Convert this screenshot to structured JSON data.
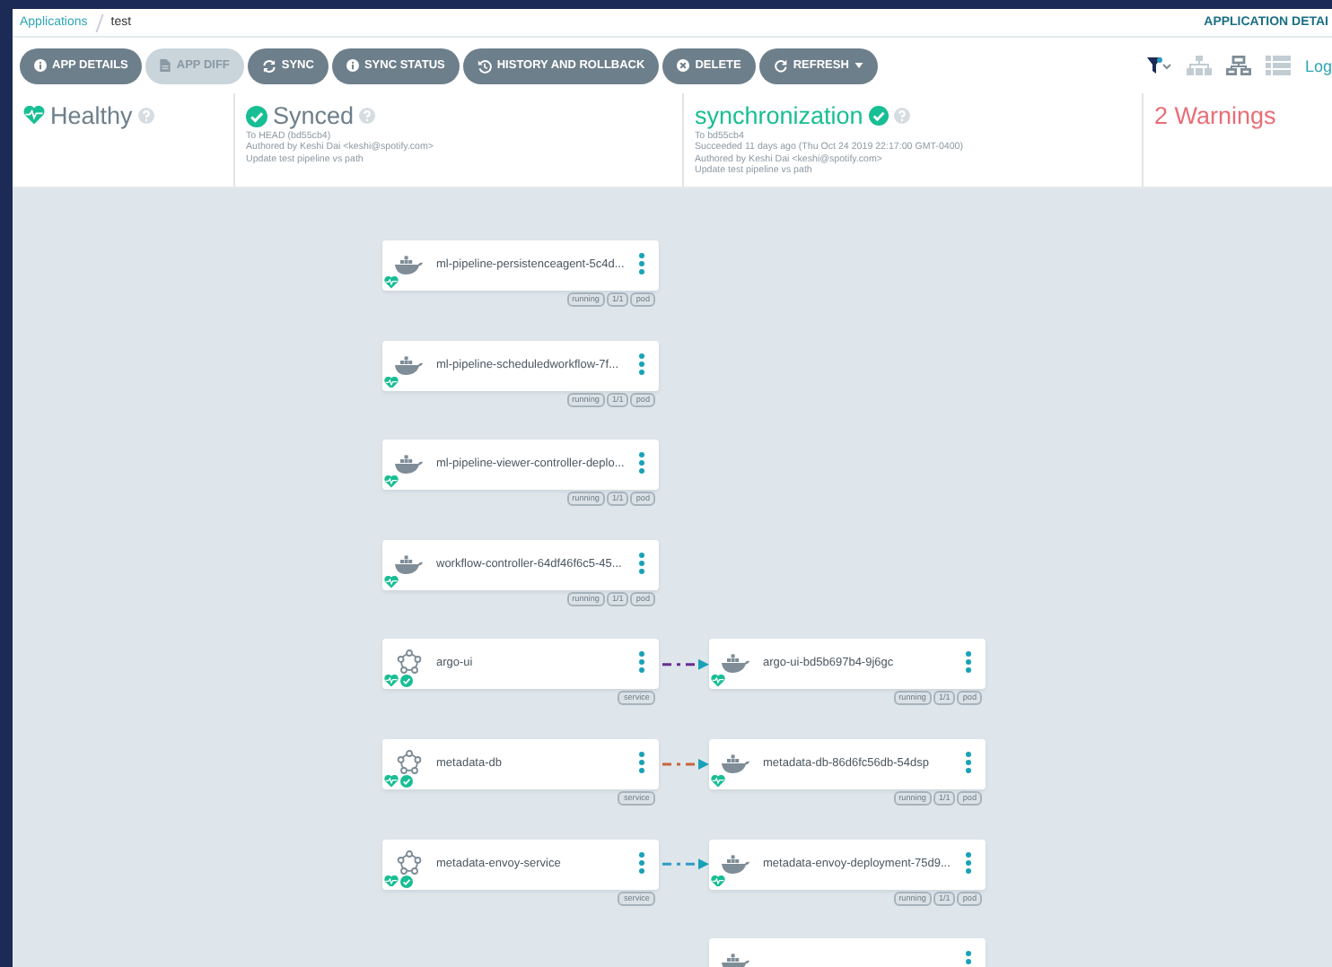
{
  "breadcrumb": [
    {
      "label": "Applications",
      "kind": "link"
    },
    {
      "label": "test",
      "kind": "current"
    }
  ],
  "page_title": "APPLICATION DETAI",
  "toolbar": [
    {
      "label": "APP DETAILS",
      "kind": "button",
      "disabled": false
    },
    {
      "label": "APP DIFF",
      "kind": "button",
      "disabled": true
    },
    {
      "label": "SYNC",
      "kind": "button",
      "disabled": false
    },
    {
      "label": "SYNC STATUS",
      "kind": "button",
      "disabled": false
    },
    {
      "label": "HISTORY AND ROLLBACK",
      "kind": "button",
      "disabled": false
    },
    {
      "label": "DELETE",
      "kind": "button",
      "disabled": false
    },
    {
      "label": "REFRESH",
      "kind": "dropdown",
      "disabled": false
    }
  ],
  "view_link": "Log",
  "status": {
    "health": "Healthy",
    "sync": {
      "title": "Synced",
      "lines": [
        "To HEAD (bd55cb4)",
        "Authored by Keshi Dai <keshi@spotify.com>",
        "Update test pipeline vs path"
      ]
    },
    "operation": {
      "title": "synchronization",
      "lines": [
        "To bd55cb4",
        "Succeeded 11 days ago (Thu Oct 24 2019 22:17:00 GMT-0400)",
        "Authored by Keshi Dai <keshi@spotify.com>",
        "Update test pipeline vs path"
      ]
    },
    "warnings": "2 Warnings"
  },
  "graph": [
    {
      "source": {
        "kind": "pod",
        "name": "ml-pipeline-persistenceagent-5c4d...",
        "tags": [
          "running",
          "1/1",
          "pod"
        ],
        "healthy": true
      }
    },
    {
      "source": {
        "kind": "pod",
        "name": "ml-pipeline-scheduledworkflow-7f...",
        "tags": [
          "running",
          "1/1",
          "pod"
        ],
        "healthy": true
      }
    },
    {
      "source": {
        "kind": "pod",
        "name": "ml-pipeline-viewer-controller-deplo...",
        "tags": [
          "running",
          "1/1",
          "pod"
        ],
        "healthy": true
      }
    },
    {
      "source": {
        "kind": "pod",
        "name": "workflow-controller-64df46f6c5-45...",
        "tags": [
          "running",
          "1/1",
          "pod"
        ],
        "healthy": true
      }
    },
    {
      "source": {
        "kind": "service",
        "name": "argo-ui",
        "tags": [
          "service"
        ],
        "healthy": true
      },
      "color": "#6a2c91",
      "target": {
        "kind": "pod",
        "name": "argo-ui-bd5b697b4-9j6gc",
        "tags": [
          "running",
          "1/1",
          "pod"
        ],
        "healthy": true
      }
    },
    {
      "source": {
        "kind": "service",
        "name": "metadata-db",
        "tags": [
          "service"
        ],
        "healthy": true
      },
      "color": "#c8643c",
      "target": {
        "kind": "pod",
        "name": "metadata-db-86d6fc56db-54dsp",
        "tags": [
          "running",
          "1/1",
          "pod"
        ],
        "healthy": true
      }
    },
    {
      "source": {
        "kind": "service",
        "name": "metadata-envoy-service",
        "tags": [
          "service"
        ],
        "healthy": true
      },
      "color": "#2f9bc4",
      "target": {
        "kind": "pod",
        "name": "metadata-envoy-deployment-75d9...",
        "tags": [
          "running",
          "1/1",
          "pod"
        ],
        "healthy": true
      }
    },
    {
      "target": {
        "kind": "pod"
      }
    }
  ]
}
